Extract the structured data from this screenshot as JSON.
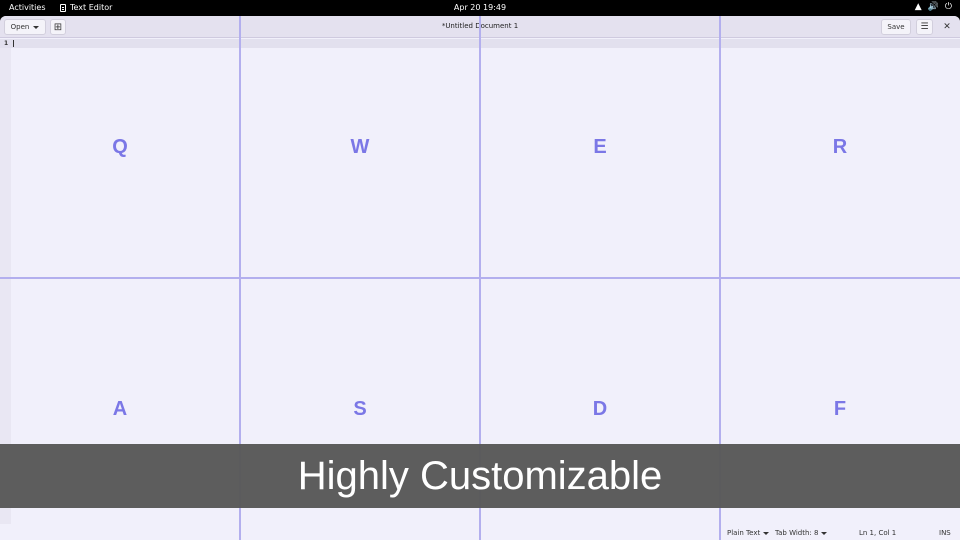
{
  "system_bar": {
    "activities": "Activities",
    "app_name": "Text Editor",
    "clock": "Apr 20  19:49",
    "icons": [
      "network-icon",
      "volume-icon",
      "power-icon"
    ]
  },
  "headerbar": {
    "open_label": "Open",
    "title": "*Untitled Document 1",
    "save_label": "Save",
    "icons": {
      "new_tab": "new-tab-icon",
      "menu": "hamburger-menu-icon",
      "close": "close-icon"
    }
  },
  "editor": {
    "line_numbers": [
      "1"
    ],
    "content": ""
  },
  "key_grid": {
    "rows": [
      [
        "Q",
        "W",
        "E",
        "R"
      ],
      [
        "A",
        "S",
        "D",
        "F"
      ]
    ],
    "colors": {
      "key_text": "#7b77e6",
      "grid_line": "#b3afee"
    }
  },
  "statusbar": {
    "language": "Plain Text",
    "tab_width": "Tab Width: 8",
    "position": "Ln 1, Col 1",
    "mode": "INS"
  },
  "caption": {
    "text": "Highly Customizable"
  },
  "colors": {
    "window_bg": "#f1f0fb",
    "headerbar_bg": "#e4e1ef",
    "caption_bg": "#585858"
  }
}
